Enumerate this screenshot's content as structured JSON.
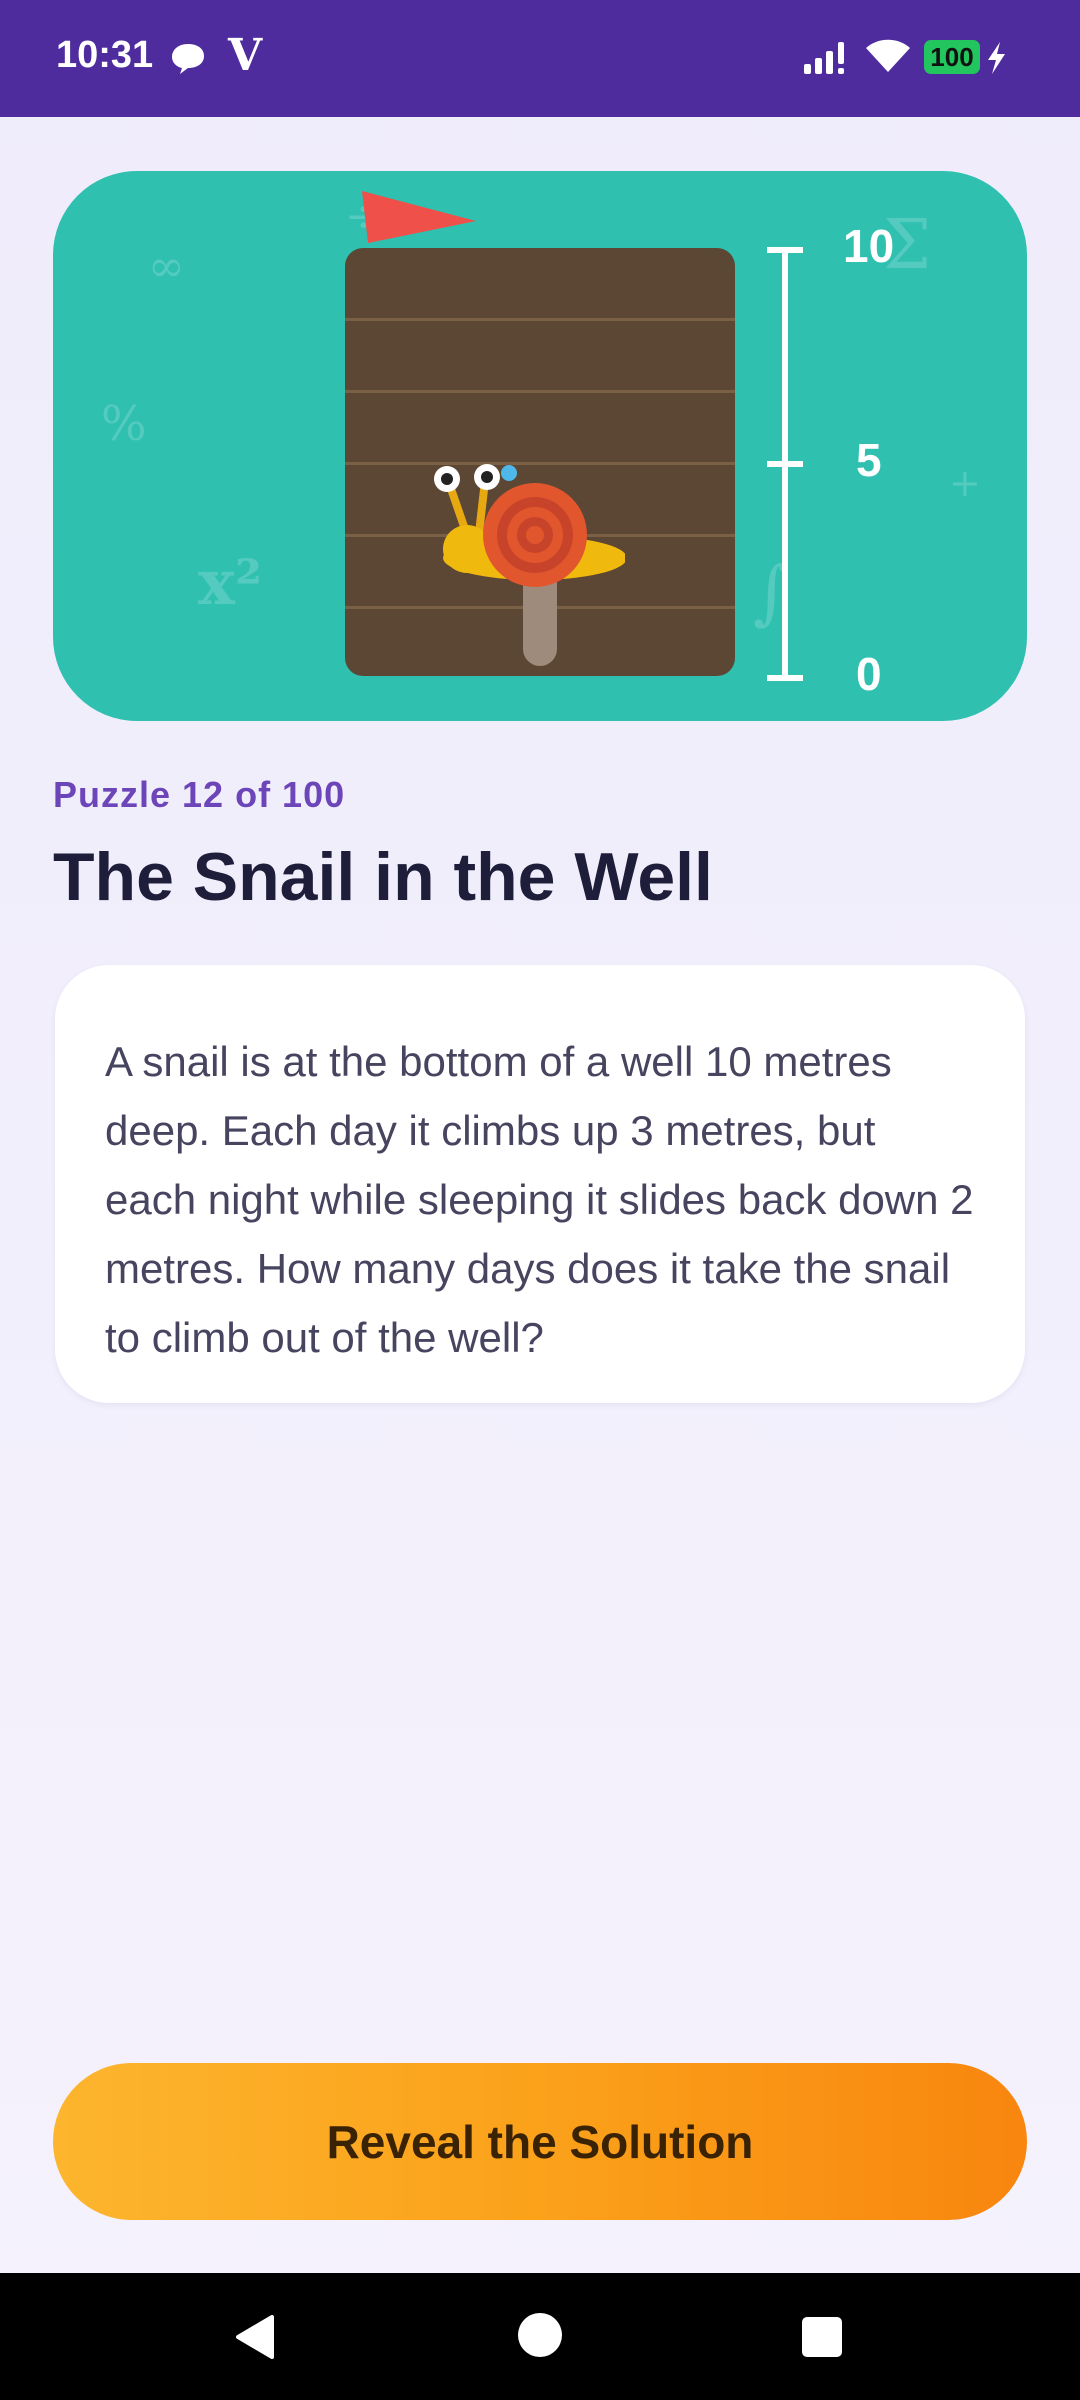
{
  "status_bar": {
    "time": "10:31",
    "carrier_glyph": "V",
    "battery": "100",
    "icons": [
      "chat-bubble-icon",
      "signal-icon",
      "wifi-icon",
      "battery-icon",
      "charging-bolt-icon"
    ]
  },
  "illustration": {
    "scale_labels": {
      "top": "10",
      "middle": "5",
      "bottom": "0"
    },
    "decorative_symbols": [
      "∞",
      "%",
      "x²",
      "Σ",
      "+",
      "∫",
      "÷"
    ],
    "colors": {
      "background": "#2fc0b0",
      "well": "#5c4634",
      "shell": "#e2562d",
      "body": "#f0b90e",
      "flag": "#f0504a"
    }
  },
  "puzzle": {
    "counter": "Puzzle 12 of 100",
    "title": "The Snail in the Well",
    "question": "A snail is at the bottom of a well 10 metres deep. Each day it climbs up 3 metres, but each night while sleeping it slides back down 2 metres. How many days does it take the snail to climb out of the well?"
  },
  "actions": {
    "reveal_label": "Reveal the Solution"
  },
  "nav": {
    "buttons": [
      "back-icon",
      "home-icon",
      "recents-icon"
    ]
  }
}
